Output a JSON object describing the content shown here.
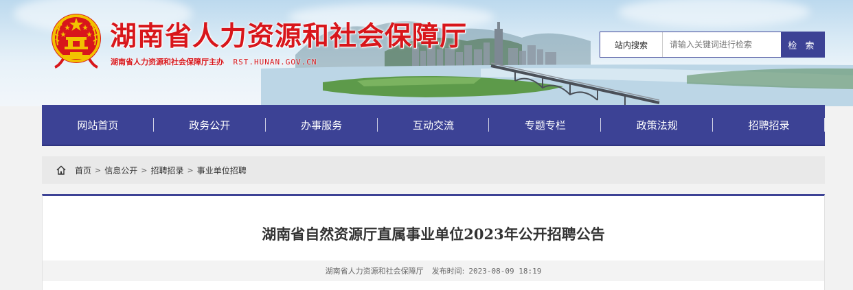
{
  "header": {
    "title": "湖南省人力资源和社会保障厅",
    "sponsor": "湖南省人力资源和社会保障厅主办",
    "domain": "RST.HUNAN.GOV.CN"
  },
  "search": {
    "scope": "站内搜索",
    "placeholder": "请输入关键词进行检索",
    "button_label": "检 索"
  },
  "nav": {
    "items": [
      "网站首页",
      "政务公开",
      "办事服务",
      "互动交流",
      "专题专栏",
      "政策法规",
      "招聘招录"
    ]
  },
  "breadcrumb": {
    "items": [
      "首页",
      "信息公开",
      "招聘招录",
      "事业单位招聘"
    ],
    "separator": ">"
  },
  "article": {
    "title": "湖南省自然资源厅直属事业单位2023年公开招聘公告",
    "source": "湖南省人力资源和社会保障厅",
    "publish_label": "发布时间:",
    "publish_time": "2023-08-09 18:19"
  },
  "colors": {
    "brand": "#3c4295",
    "title_red": "#d8161b",
    "gold": "#f2c200"
  }
}
